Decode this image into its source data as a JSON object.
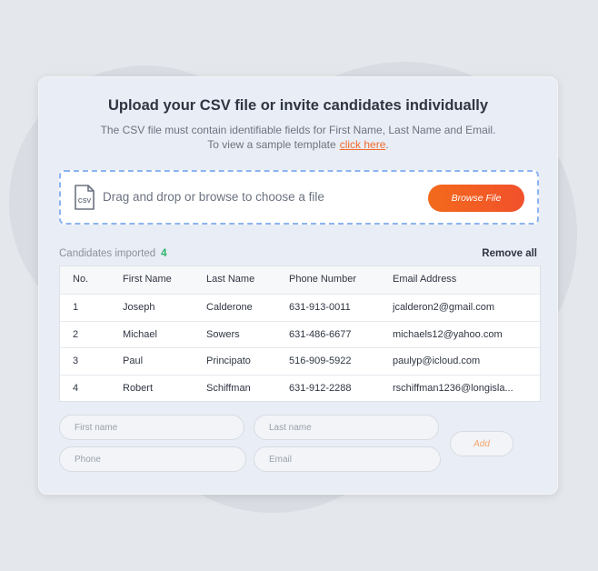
{
  "header": {
    "title": "Upload your CSV file or invite candidates individually",
    "subtitle_line1": "The CSV file must contain identifiable fields for First Name, Last Name and Email.",
    "subtitle_line2": "To view a sample template",
    "template_link": "click here",
    "trailing_period": "."
  },
  "dropzone": {
    "icon": "csv-file-icon",
    "icon_text": "CSV",
    "text": "Drag and drop or browse to choose a file",
    "browse_label": "Browse File"
  },
  "imported": {
    "label": "Candidates imported",
    "count": "4",
    "remove_all": "Remove all"
  },
  "table": {
    "headers": [
      "No.",
      "First Name",
      "Last Name",
      "Phone Number",
      "Email Address"
    ],
    "rows": [
      [
        "1",
        "Joseph",
        "Calderone",
        "631-913-0011",
        "jcalderon2@gmail.com"
      ],
      [
        "2",
        "Michael",
        "Sowers",
        "631-486-6677",
        "michaels12@yahoo.com"
      ],
      [
        "3",
        "Paul",
        "Principato",
        "516-909-5922",
        "paulyp@icloud.com"
      ],
      [
        "4",
        "Robert",
        "Schiffman",
        "631-912-2288",
        "rschiffman1236@longisla..."
      ]
    ]
  },
  "form": {
    "first_name_placeholder": "First name",
    "last_name_placeholder": "Last name",
    "phone_placeholder": "Phone",
    "email_placeholder": "Email",
    "add_label": "Add"
  },
  "colors": {
    "accent": "#f26a1c",
    "count": "#2ab36a",
    "dropzone_border": "#8cb4f0"
  }
}
